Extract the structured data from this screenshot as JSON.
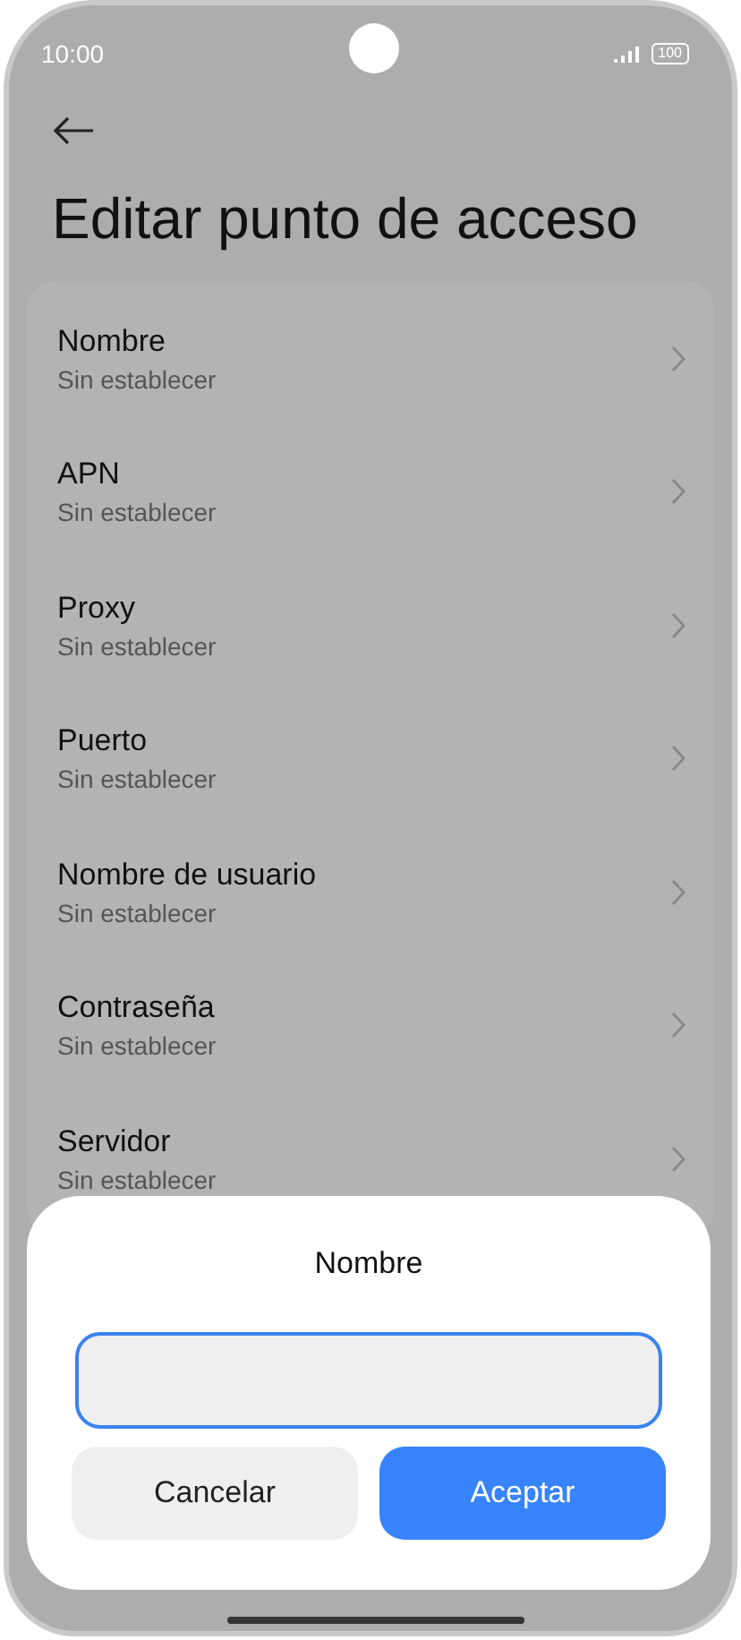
{
  "status_bar": {
    "time": "10:00",
    "battery": "100"
  },
  "title": "Editar punto de acceso",
  "settings": [
    {
      "label": "Nombre",
      "value": "Sin establecer"
    },
    {
      "label": "APN",
      "value": "Sin establecer"
    },
    {
      "label": "Proxy",
      "value": "Sin establecer"
    },
    {
      "label": "Puerto",
      "value": "Sin establecer"
    },
    {
      "label": "Nombre de usuario",
      "value": "Sin establecer"
    },
    {
      "label": "Contraseña",
      "value": "Sin establecer"
    },
    {
      "label": "Servidor",
      "value": "Sin establecer"
    }
  ],
  "dialog": {
    "title": "Nombre",
    "buttons": [
      {
        "label": "Cancelar",
        "kind": "secondary"
      },
      {
        "label": "Aceptar",
        "kind": "primary"
      }
    ]
  }
}
